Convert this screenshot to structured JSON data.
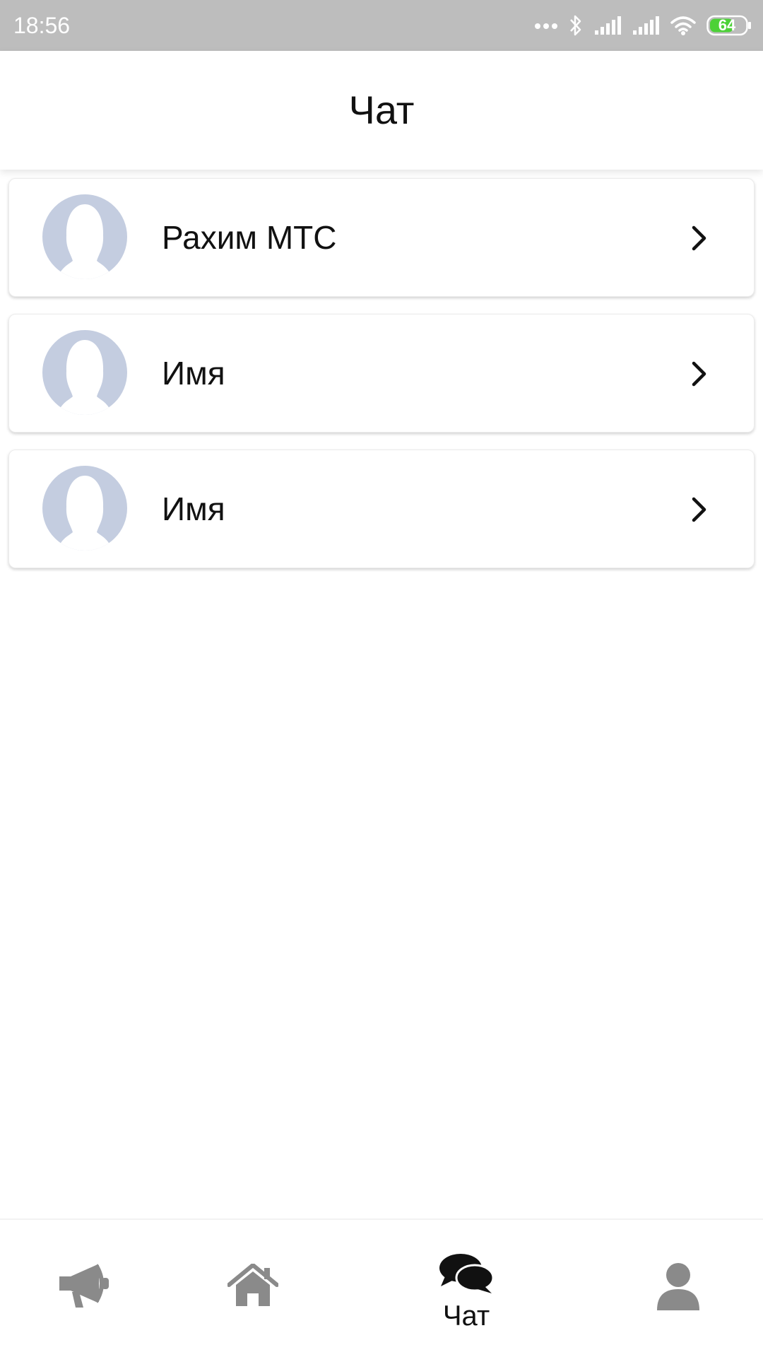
{
  "status_bar": {
    "time": "18:56",
    "battery": "64",
    "battery_color": "#4cd137",
    "icons": [
      "more-dots-icon",
      "bluetooth-icon",
      "signal-icon",
      "signal-icon",
      "wifi-icon",
      "battery-icon"
    ]
  },
  "header": {
    "title": "Чат"
  },
  "chats": [
    {
      "name": "Рахим МТС",
      "avatar_icon": "avatar-placeholder-icon"
    },
    {
      "name": "Имя",
      "avatar_icon": "avatar-placeholder-icon"
    },
    {
      "name": "Имя",
      "avatar_icon": "avatar-placeholder-icon"
    }
  ],
  "bottom_nav": {
    "items": [
      {
        "icon": "megaphone-icon",
        "label": "",
        "active": false
      },
      {
        "icon": "home-icon",
        "label": "",
        "active": false
      },
      {
        "icon": "chat-bubbles-icon",
        "label": "Чат",
        "active": true
      },
      {
        "icon": "user-icon",
        "label": "",
        "active": false
      }
    ],
    "active_color": "#111111",
    "inactive_color": "#8a8a8a"
  },
  "colors": {
    "avatar_bg": "#c4cde0",
    "status_bar_bg": "#bdbdbd"
  }
}
